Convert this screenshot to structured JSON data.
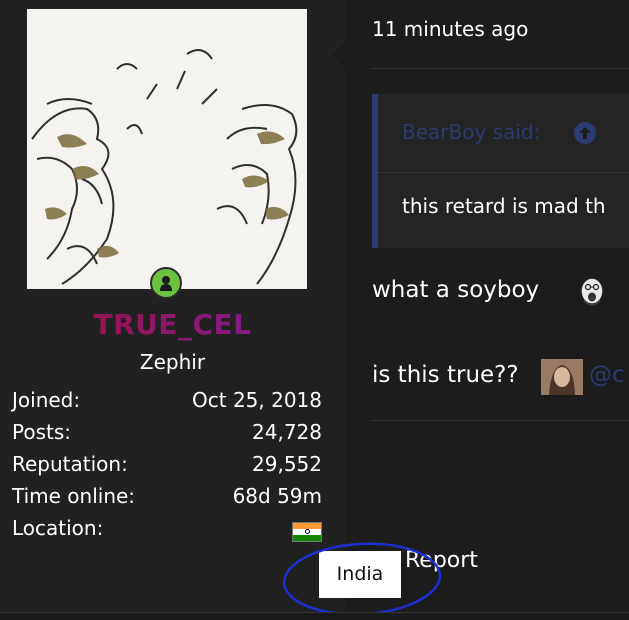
{
  "user": {
    "username": "TRUE_CEL",
    "title": "Zephir",
    "online_status_icon": "online-user-icon",
    "stats": [
      {
        "label": "Joined:",
        "value": "Oct 25, 2018"
      },
      {
        "label": "Posts:",
        "value": "24,728"
      },
      {
        "label": "Reputation:",
        "value": "29,552"
      },
      {
        "label": "Time online:",
        "value": "68d 59m"
      },
      {
        "label": "Location:",
        "value": ""
      }
    ],
    "location_flag": "india-flag-icon"
  },
  "tooltip": {
    "text": "India"
  },
  "actions": {
    "report_label": "Report"
  },
  "post": {
    "timestamp": "11 minutes ago",
    "quote": {
      "author_line": "BearBoy said:",
      "body": "this retard is mad th"
    },
    "line1": "what a soyboy",
    "line2": "is this true??",
    "mention": "@c"
  },
  "colors": {
    "background": "#1c1c1c",
    "sidebar": "#212121",
    "quote_accent": "#2b3c72",
    "username_gradient_start": "#a01030",
    "username_gradient_end": "#7a1fa8",
    "online": "#6cc23f",
    "annotation": "#1c2fd0"
  }
}
